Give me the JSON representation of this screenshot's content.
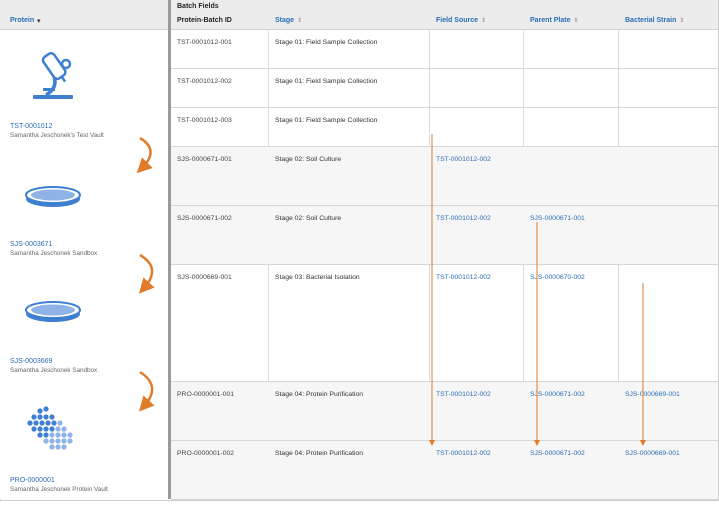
{
  "left_header": {
    "label": "Protein"
  },
  "proteins": [
    {
      "id": "TST-0001012",
      "vault": "Samantha Jeschonek's Test Vault",
      "icon": "microscope-icon"
    },
    {
      "id": "SJS-0003671",
      "vault": "Samantha Jeschonek Sandbox",
      "icon": "petri-dish-icon"
    },
    {
      "id": "SJS-0003669",
      "vault": "Samantha Jeschonek Sandbox",
      "icon": "petri-dish-icon"
    },
    {
      "id": "PRO-0000001",
      "vault": "Samantha Jeschonek Protein Vault",
      "icon": "protein-structure-icon"
    }
  ],
  "batch_header": {
    "section": "Batch Fields",
    "col_id": "Protein-Batch ID",
    "col_stage": "Stage",
    "col_field_source": "Field Source",
    "col_parent_plate": "Parent Plate",
    "col_bacterial_strain": "Bacterial Strain"
  },
  "rows": [
    {
      "id": "TST-0001012-001",
      "stage": "Stage 01: Field Sample Collection",
      "field_source": "",
      "parent_plate": "",
      "bacterial_strain": ""
    },
    {
      "id": "TST-0001012-002",
      "stage": "Stage 01: Field Sample Collection",
      "field_source": "",
      "parent_plate": "",
      "bacterial_strain": ""
    },
    {
      "id": "TST-0001012-003",
      "stage": "Stage 01: Field Sample Collection",
      "field_source": "",
      "parent_plate": "",
      "bacterial_strain": ""
    },
    {
      "id": "SJS-0000671-001",
      "stage": "Stage 02: Soil Culture",
      "field_source": "TST-0001012-002",
      "parent_plate": "",
      "bacterial_strain": ""
    },
    {
      "id": "SJS-0000671-002",
      "stage": "Stage 02: Soil Culture",
      "field_source": "TST-0001012-002",
      "parent_plate": "SJS-0000671-001",
      "bacterial_strain": ""
    },
    {
      "id": "SJS-0000669-001",
      "stage": "Stage 03: Bacterial Isolation",
      "field_source": "TST-0001012-002",
      "parent_plate": "SJS-0000670-002",
      "bacterial_strain": ""
    },
    {
      "id": "PRO-0000001-001",
      "stage": "Stage 04: Protein Purification",
      "field_source": "TST-0001012-002",
      "parent_plate": "SJS-0000671-002",
      "bacterial_strain": "SJS-0000669-001"
    },
    {
      "id": "PRO-0000001-002",
      "stage": "Stage 04: Protein Purification",
      "field_source": "TST-0001012-002",
      "parent_plate": "SJS-0000671-002",
      "bacterial_strain": "SJS-0000669-001"
    }
  ],
  "colors": {
    "link": "#2a6db5",
    "arrow": "#e07b2a",
    "icon": "#3f7fd1"
  }
}
